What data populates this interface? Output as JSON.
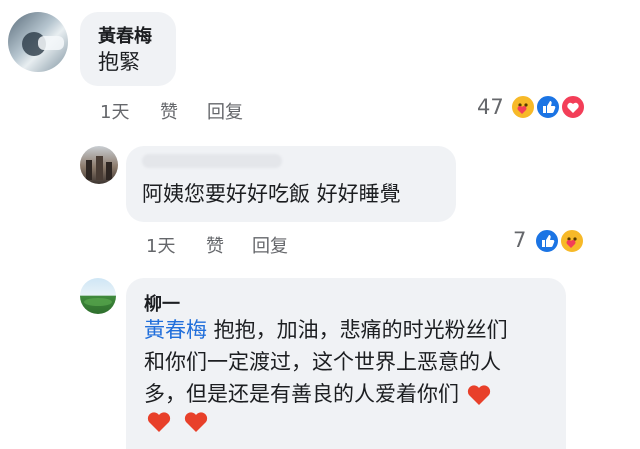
{
  "comments": [
    {
      "author": "黃春梅",
      "text": "抱緊",
      "time": "1天",
      "like_label": "赞",
      "reply_label": "回复",
      "reaction_count": "47",
      "reaction_icons": [
        "care-icon",
        "like-icon",
        "love-icon"
      ]
    },
    {
      "author": "",
      "text": "阿姨您要好好吃飯 好好睡覺",
      "time": "1天",
      "like_label": "赞",
      "reply_label": "回复",
      "reaction_count": "7",
      "reaction_icons": [
        "like-icon",
        "care-icon"
      ]
    },
    {
      "author": "柳一",
      "mention": "黃春梅",
      "text_line1": " 抱抱，加油，悲痛的时光粉丝们",
      "text_line2": "和你们一定渡过，这个世界上恶意的人",
      "text_line3": "多，但是还是有善良的人爱着你们"
    }
  ],
  "colors": {
    "bubble": "#f0f2f5",
    "mention": "#216fdb",
    "like_blue": "#1b74e4",
    "love_red": "#f33e58",
    "care_yellow": "#f7b928"
  }
}
